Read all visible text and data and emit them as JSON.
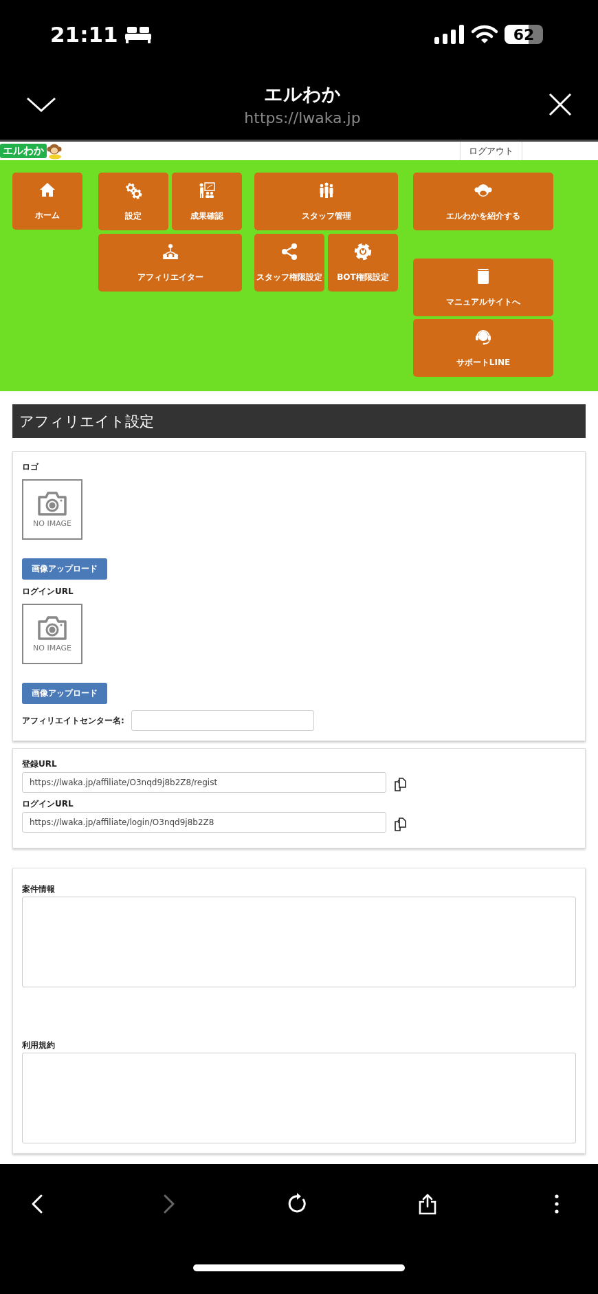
{
  "status_bar": {
    "time": "21:11",
    "battery": "62"
  },
  "browser": {
    "title": "エルわか",
    "url": "https://lwaka.jp"
  },
  "site": {
    "logo": "エルわか",
    "logout": "ログアウト"
  },
  "nav": [
    [
      {
        "label": "ホーム"
      }
    ],
    [
      {
        "label": "設定"
      },
      {
        "label": "成果確認"
      },
      {
        "label": "アフィリエイター"
      }
    ],
    [
      {
        "label": "スタッフ管理"
      },
      {
        "label": "スタッフ権限設定"
      },
      {
        "label": "BOT権限設定"
      }
    ],
    [
      {
        "label": "エルわかを紹介する"
      },
      {
        "label": "マニュアルサイトへ"
      },
      {
        "label": "サポートLINE"
      }
    ]
  ],
  "page_title": "アフィリエイト設定",
  "settings_card": {
    "images": [
      {
        "label": "ロゴ",
        "placeholder": "NO IMAGE",
        "button": "画像アップロード"
      },
      {
        "label": "ログインURL",
        "placeholder": "NO IMAGE",
        "button": "画像アップロード"
      }
    ],
    "center_name": {
      "label": "アフィリエイトセンター名:"
    }
  },
  "url_card": [
    {
      "label": "登録URL",
      "value": "https://lwaka.jp/affiliate/O3nqd9j8b2Z8/regist"
    },
    {
      "label": "ログインURL",
      "value": "https://lwaka.jp/affiliate/login/O3nqd9j8b2Z8"
    }
  ],
  "text_card": [
    {
      "label": "案件情報"
    },
    {
      "label": "利用規約"
    }
  ],
  "toolbar": [
    {
      "kind": "back",
      "disabled": false
    },
    {
      "kind": "forward",
      "disabled": true
    },
    {
      "kind": "reload",
      "disabled": false
    },
    {
      "kind": "share",
      "disabled": false
    },
    {
      "kind": "more",
      "disabled": false
    }
  ]
}
